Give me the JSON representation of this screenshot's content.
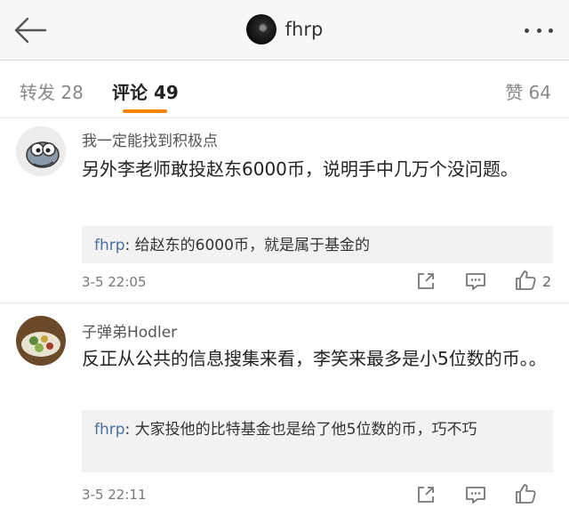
{
  "header": {
    "title": "fhrp"
  },
  "tabs": {
    "forward": "转发 28",
    "comment": "评论 49",
    "like": "赞 64"
  },
  "comments": [
    {
      "username": "我一定能找到积极点",
      "text": "另外李老师敢投赵东6000币，说明手中几万个没问题。",
      "reply_name": "fhrp",
      "reply_text": ": 给赵东的6000币，就是属于基金的",
      "time": "3-5 22:05",
      "likes": "2"
    },
    {
      "username": "子弹弟Hodler",
      "text": "反正从公共的信息搜集来看，李笑来最多是小5位数的币。。",
      "reply_name": "fhrp",
      "reply_text": ": 大家投他的比特基金也是给了他5位数的币，巧不巧",
      "time": "3-5 22:11",
      "likes": ""
    }
  ],
  "icons": {
    "back": "arrow-left-icon",
    "more": "more-dots-icon",
    "share": "share-icon",
    "reply": "comment-bubble-icon",
    "like": "thumbs-up-icon"
  },
  "colors": {
    "accent": "#ff8200",
    "link": "#4a6fa0"
  }
}
